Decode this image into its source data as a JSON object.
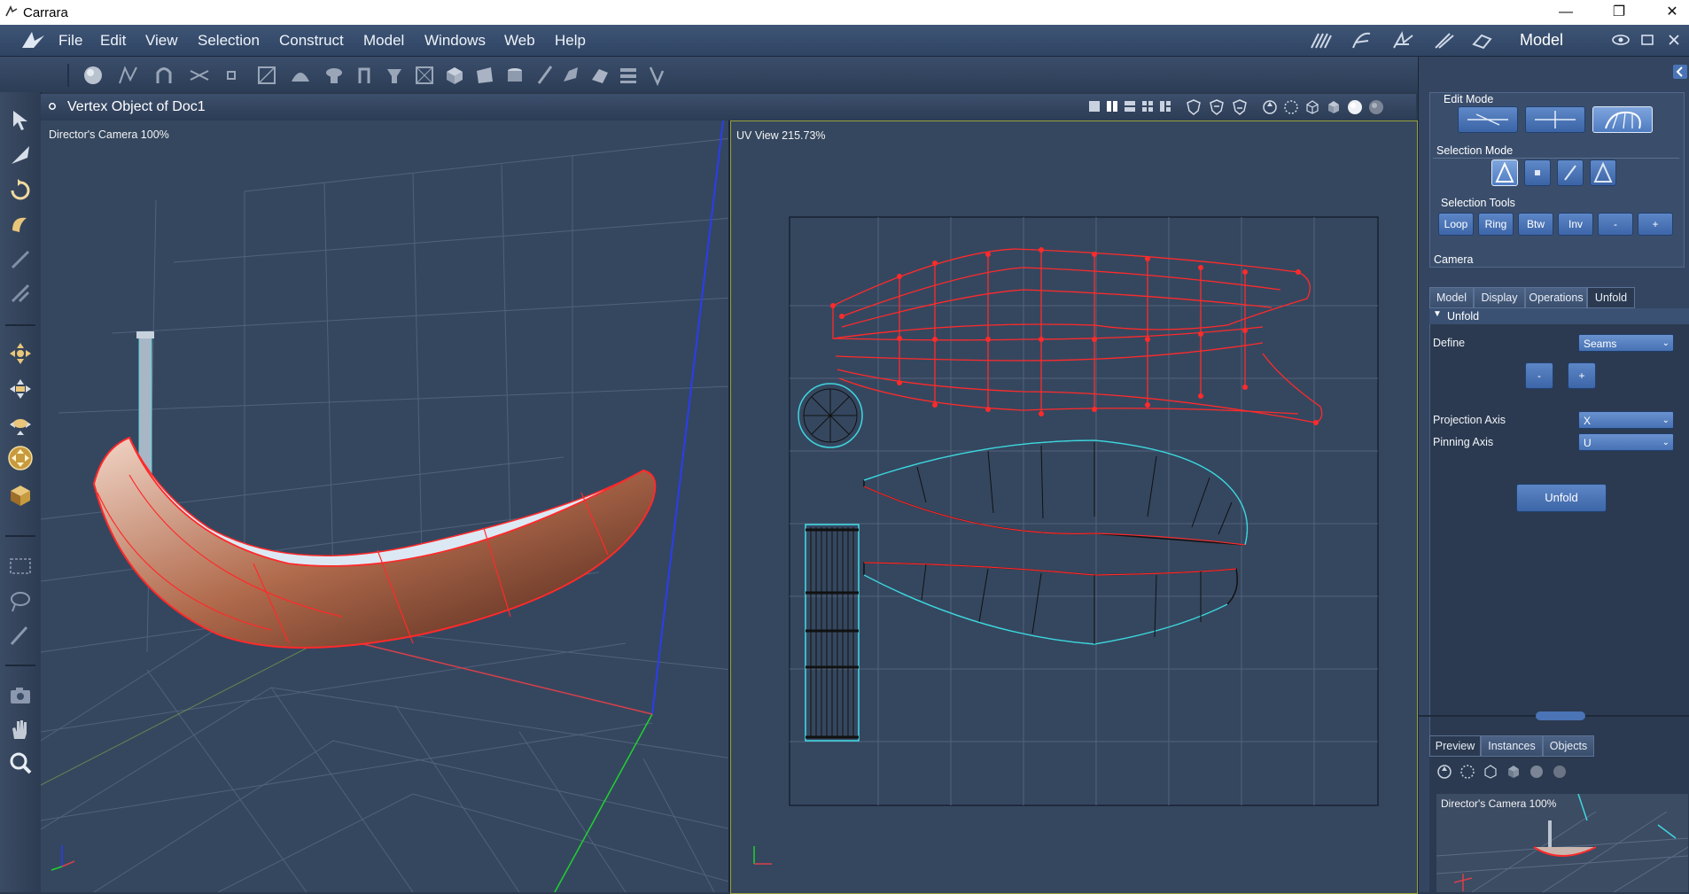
{
  "window": {
    "title": "Carrara",
    "minimize": "—",
    "restore": "❐",
    "close": "✕"
  },
  "menubar": {
    "items": [
      "File",
      "Edit",
      "View",
      "Selection",
      "Construct",
      "Model",
      "Windows",
      "Web",
      "Help"
    ],
    "room": "Model"
  },
  "toolbar": {
    "icons": [
      "sphere-icon",
      "spline-icon",
      "magnet-icon",
      "scissors-icon",
      "vertex-icon",
      "box-select-icon",
      "dome-icon",
      "lathe-icon",
      "extrude-icon",
      "bevel-icon",
      "face-icon",
      "box-icon",
      "plane-icon",
      "cylinder-icon",
      "cone-icon",
      "brush-icon",
      "smooth-icon",
      "morph-icon",
      "symmetry-icon",
      "text-icon"
    ]
  },
  "view": {
    "title": "Vertex Object of Doc1",
    "left_label": "Director's Camera 100%",
    "right_label": "UV View 215.73%"
  },
  "panel": {
    "edit_mode_label": "Edit Mode",
    "selection_mode_label": "Selection Mode",
    "selection_tools_label": "Selection Tools",
    "selection_tools": [
      "Loop",
      "Ring",
      "Btw",
      "Inv",
      "-",
      "+"
    ],
    "camera_label": "Camera",
    "tabs": [
      "Model",
      "Display",
      "Operations",
      "Unfold"
    ],
    "active_tab": "Unfold",
    "section_title": "Unfold",
    "define_label": "Define",
    "define_value": "Seams",
    "minus_label": "-",
    "plus_label": "+",
    "projection_axis_label": "Projection Axis",
    "projection_axis_value": "X",
    "pinning_axis_label": "Pinning Axis",
    "pinning_axis_value": "U",
    "unfold_button": "Unfold",
    "bottom_tabs": [
      "Preview",
      "Instances",
      "Objects"
    ],
    "preview_label": "Director's Camera 100%"
  },
  "colors": {
    "accent": "#4a74b6",
    "uv_red": "#ff2a2a",
    "uv_cyan": "#3fd6e0",
    "bg": "#35475f"
  }
}
